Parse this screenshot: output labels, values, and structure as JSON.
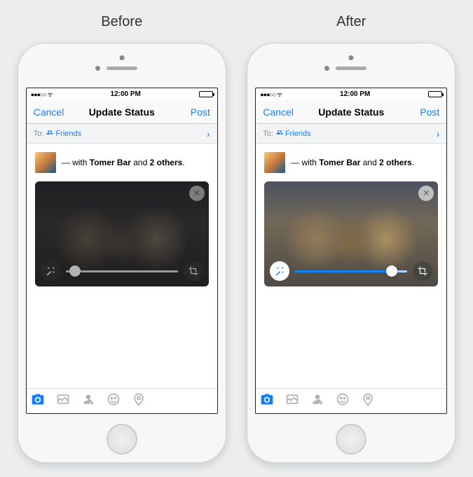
{
  "labels": {
    "before": "Before",
    "after": "After"
  },
  "statusbar": {
    "time": "12:00 PM"
  },
  "navbar": {
    "cancel": "Cancel",
    "title": "Update Status",
    "post": "Post"
  },
  "audience": {
    "to": "To:",
    "value": "Friends"
  },
  "composer": {
    "prefix": " — with ",
    "person": "Tomer Bar",
    "connector": " and ",
    "others": "2 others",
    "suffix": "."
  },
  "slider": {
    "before_percent": "8",
    "after_percent": "86"
  }
}
